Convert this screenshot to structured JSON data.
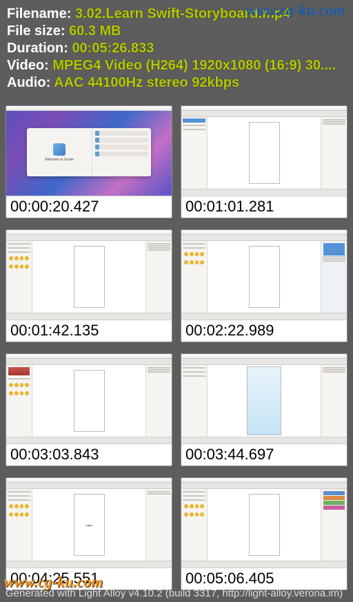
{
  "watermarks": {
    "top": "www.cg-ku.com",
    "bottom": "www.cg-ku.com"
  },
  "metadata": {
    "filename_label": "Filename: ",
    "filename_value": "3.02.Learn Swift-Storyboard.mp4",
    "filesize_label": "File size: ",
    "filesize_value": "60.3 MB",
    "duration_label": "Duration: ",
    "duration_value": "00:05:26.833",
    "video_label": "Video: ",
    "video_value": "MPEG4 Video (H264) 1920x1080 (16:9) 30....",
    "audio_label": "Audio: ",
    "audio_value": "AAC 44100Hz stereo 92kbps"
  },
  "thumbnails": [
    {
      "timecode": "00:00:20.427",
      "desc": "xcode-welcome"
    },
    {
      "timecode": "00:01:01.281",
      "desc": "storyboard-empty"
    },
    {
      "timecode": "00:01:42.135",
      "desc": "storyboard-sidebar"
    },
    {
      "timecode": "00:02:22.989",
      "desc": "storyboard-inspector"
    },
    {
      "timecode": "00:03:03.843",
      "desc": "storyboard-image"
    },
    {
      "timecode": "00:03:44.697",
      "desc": "storyboard-blue"
    },
    {
      "timecode": "00:04:25.551",
      "desc": "storyboard-label"
    },
    {
      "timecode": "00:05:06.405",
      "desc": "storyboard-components"
    }
  ],
  "footer": "Generated with Light Alloy v4.10.2 (build 3317, http://light-alloy.verona.im)",
  "xcode_title": "Welcome to Xcode"
}
